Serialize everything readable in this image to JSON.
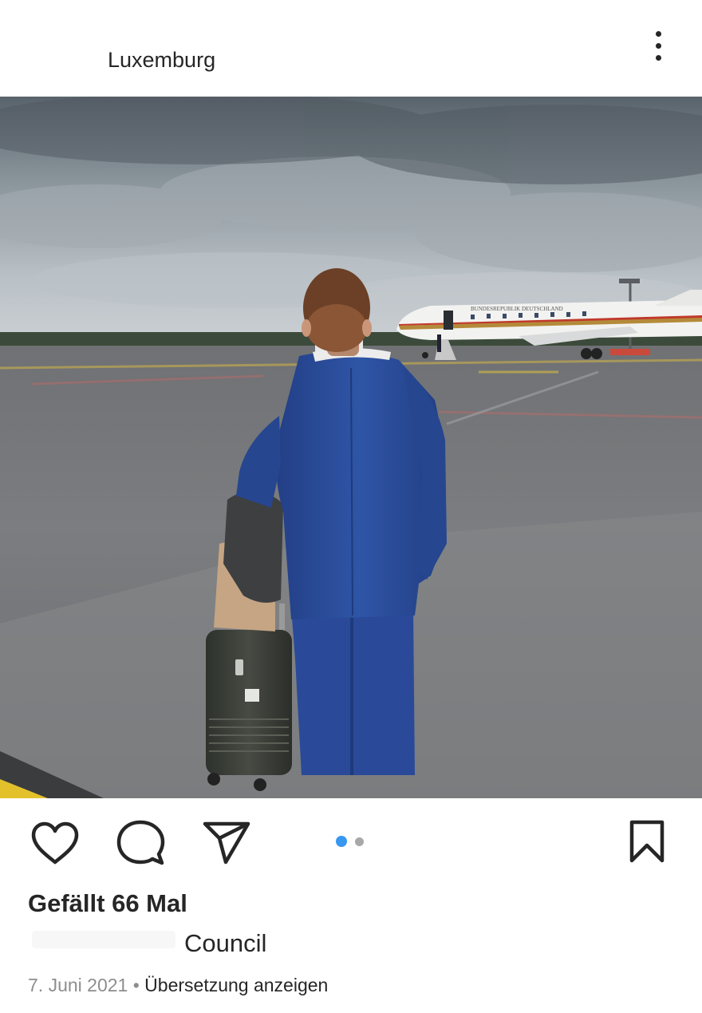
{
  "post": {
    "location": "Luxemburg",
    "likes_text": "Gefällt 66 Mal",
    "caption_text": "Council",
    "date": "7. Juni 2021",
    "separator": " • ",
    "translate_link": "Übersetzung anzeigen"
  },
  "carousel": {
    "count": 2,
    "active_index": 0,
    "active_color": "#3897f0",
    "inactive_color": "#a8a8a8"
  },
  "icons": {
    "more": "more-vertical-icon",
    "like": "heart-icon",
    "comment": "comment-icon",
    "share": "paper-plane-icon",
    "save": "bookmark-icon"
  },
  "aircraft_livery": "BUNDESREPUBLIK DEUTSCHLAND"
}
